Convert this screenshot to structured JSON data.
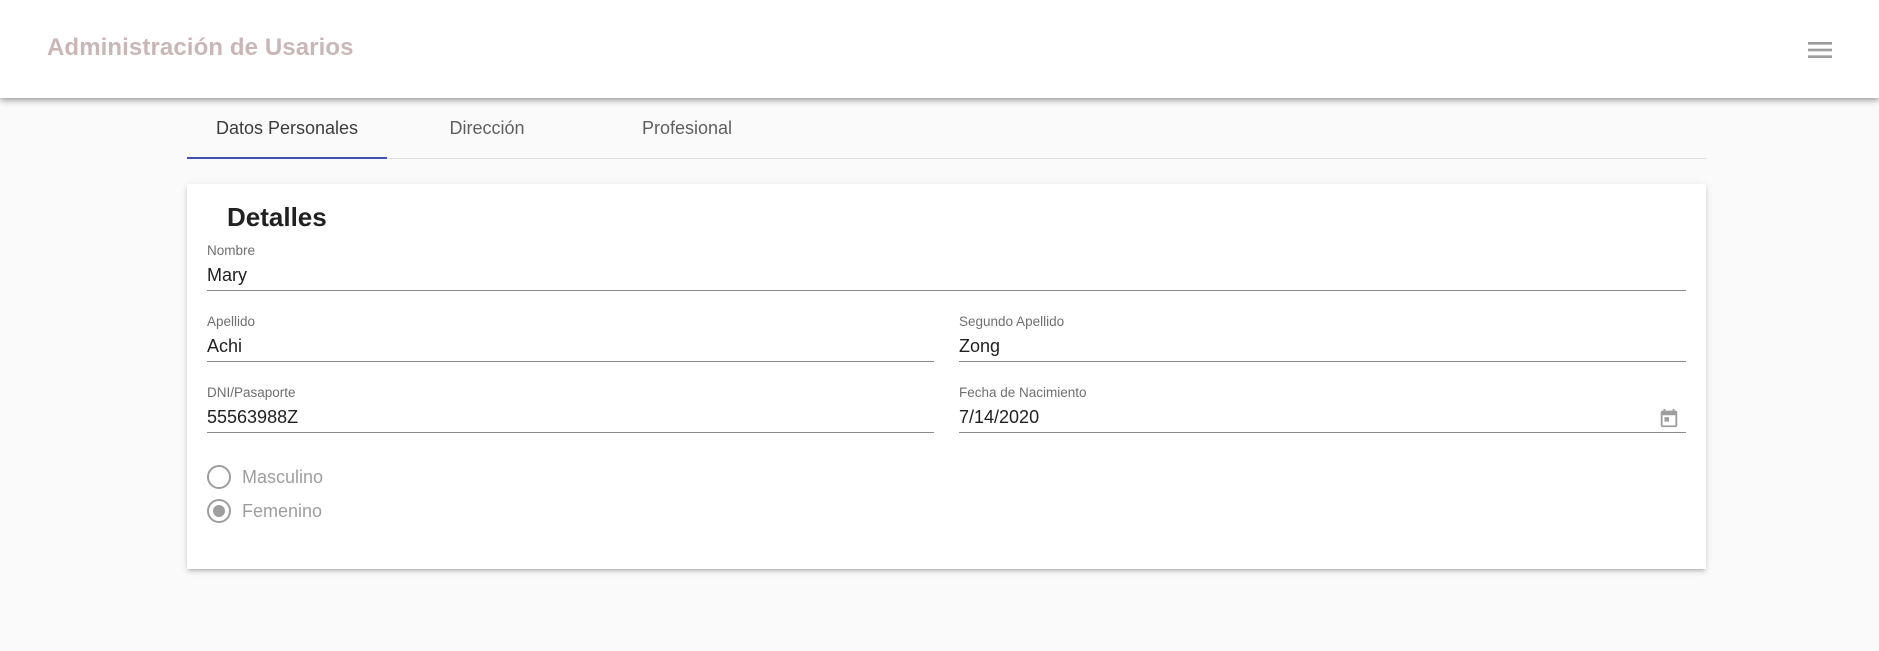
{
  "toolbar": {
    "title": "Administración de Usarios",
    "menu_icon": "hamburger-menu-icon"
  },
  "tabs": [
    {
      "label": "Datos Personales",
      "active": true
    },
    {
      "label": "Dirección",
      "active": false
    },
    {
      "label": "Profesional",
      "active": false
    }
  ],
  "colors": {
    "tab_ink": "#3f51b5",
    "title": "#c9b7b7",
    "background": "#fafafa"
  },
  "card": {
    "title": "Detalles",
    "fields": {
      "nombre": {
        "label": "Nombre",
        "value": "Mary"
      },
      "apellido": {
        "label": "Apellido",
        "value": "Achi"
      },
      "segundo_apellido": {
        "label": "Segundo Apellido",
        "value": "Zong"
      },
      "dni": {
        "label": "DNI/Pasaporte",
        "value": "55563988Z"
      },
      "fecha": {
        "label": "Fecha de Nacimiento",
        "value": "7/14/2020",
        "icon": "calendar-icon"
      }
    },
    "gender": {
      "options": [
        {
          "label": "Masculino",
          "selected": false
        },
        {
          "label": "Femenino",
          "selected": true
        }
      ]
    }
  }
}
